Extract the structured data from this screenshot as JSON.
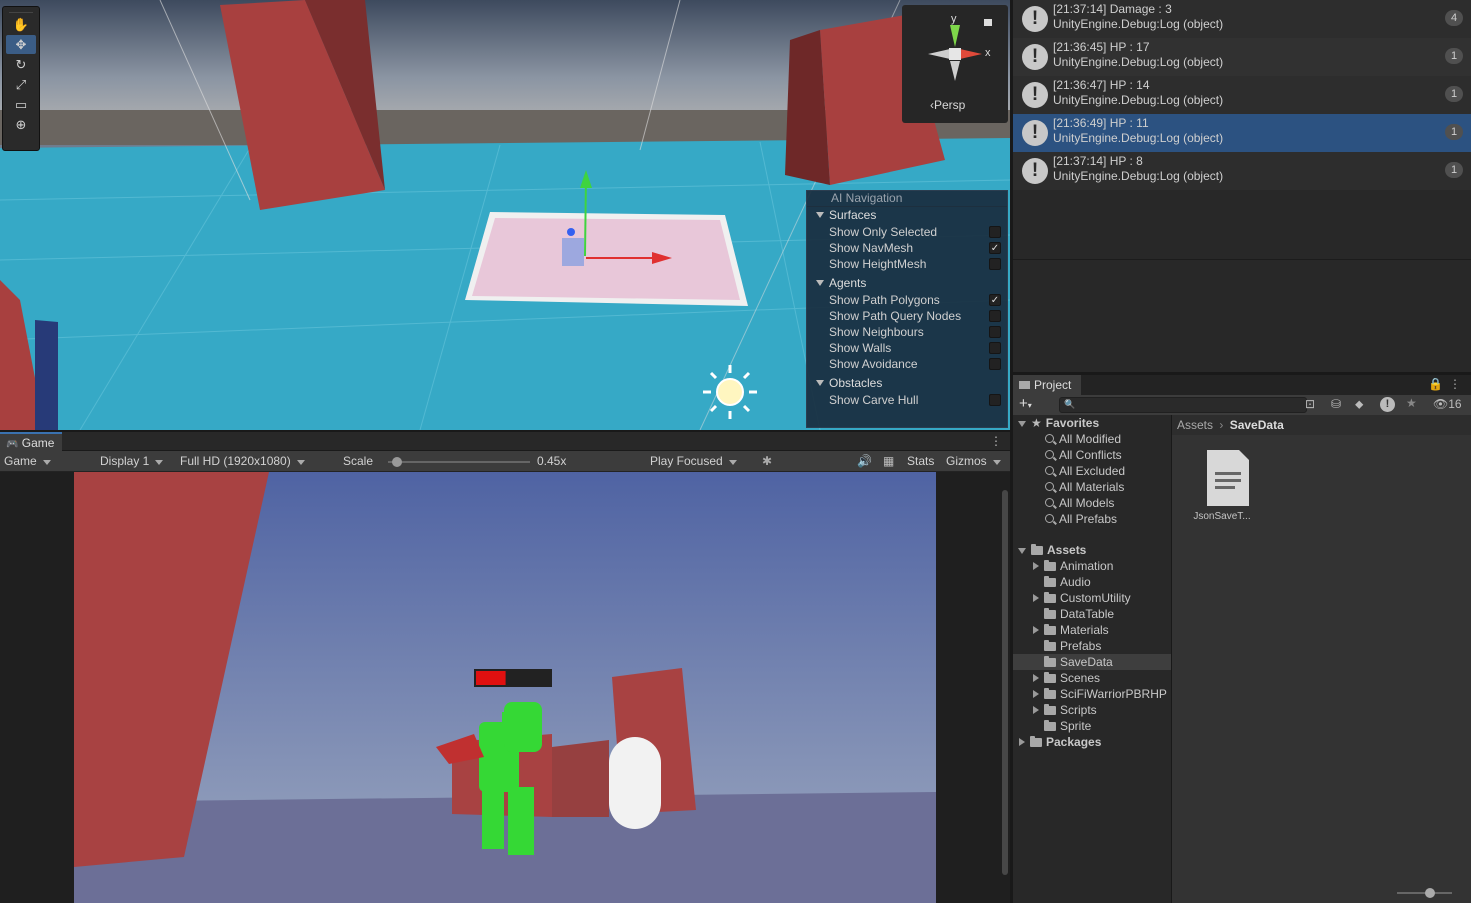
{
  "scene": {
    "tools": [
      "hand-tool",
      "move-tool",
      "rotate-tool",
      "scale-tool",
      "rect-tool",
      "transform-tool"
    ],
    "gizmo_axis": "y",
    "gizmo_x": "x",
    "projection": "Persp",
    "ai_navigation": {
      "title": "AI Navigation",
      "sections": [
        {
          "label": "Surfaces",
          "options": [
            {
              "label": "Show Only Selected",
              "checked": false
            },
            {
              "label": "Show NavMesh",
              "checked": true
            },
            {
              "label": "Show HeightMesh",
              "checked": false
            }
          ]
        },
        {
          "label": "Agents",
          "options": [
            {
              "label": "Show Path Polygons",
              "checked": true
            },
            {
              "label": "Show Path Query Nodes",
              "checked": false
            },
            {
              "label": "Show Neighbours",
              "checked": false
            },
            {
              "label": "Show Walls",
              "checked": false
            },
            {
              "label": "Show Avoidance",
              "checked": false
            }
          ]
        },
        {
          "label": "Obstacles",
          "options": [
            {
              "label": "Show Carve Hull",
              "checked": false
            }
          ]
        }
      ]
    }
  },
  "game": {
    "tab": "Game",
    "mode": "Game",
    "display": "Display 1",
    "resolution": "Full HD (1920x1080)",
    "scale_label": "Scale",
    "scale_value": "0.45x",
    "scale_fraction": 0.06,
    "play_mode": "Play Focused",
    "stats": "Stats",
    "gizmos": "Gizmos",
    "hp_fraction": 0.4,
    "colors": {
      "sky": "#5f70a8",
      "ground": "#6a6f96",
      "wall": "#a64444",
      "player": "#2fd32f",
      "hp": "#e01010"
    }
  },
  "console": {
    "logs": [
      {
        "line1": "[21:37:14] Damage : 3",
        "line2": "UnityEngine.Debug:Log (object)",
        "count": "4"
      },
      {
        "line1": "[21:36:45] HP : 17",
        "line2": "UnityEngine.Debug:Log (object)",
        "count": "1"
      },
      {
        "line1": "[21:36:47] HP : 14",
        "line2": "UnityEngine.Debug:Log (object)",
        "count": "1"
      },
      {
        "line1": "[21:36:49] HP : 11",
        "line2": "UnityEngine.Debug:Log (object)",
        "count": "1"
      },
      {
        "line1": "[21:37:14] HP : 8",
        "line2": "UnityEngine.Debug:Log (object)",
        "count": "1"
      }
    ],
    "selected_index": 3
  },
  "project": {
    "tab": "Project",
    "search_placeholder": "",
    "hidden_count": "16",
    "favorites_label": "Favorites",
    "favorites": [
      "All Modified",
      "All Conflicts",
      "All Excluded",
      "All Materials",
      "All Models",
      "All Prefabs"
    ],
    "assets_label": "Assets",
    "assets": [
      {
        "label": "Animation",
        "expandable": true
      },
      {
        "label": "Audio",
        "expandable": false
      },
      {
        "label": "CustomUtility",
        "expandable": true
      },
      {
        "label": "DataTable",
        "expandable": false
      },
      {
        "label": "Materials",
        "expandable": true
      },
      {
        "label": "Prefabs",
        "expandable": false
      },
      {
        "label": "SaveData",
        "expandable": false,
        "selected": true
      },
      {
        "label": "Scenes",
        "expandable": true
      },
      {
        "label": "SciFiWarriorPBRHP",
        "expandable": true
      },
      {
        "label": "Scripts",
        "expandable": true
      },
      {
        "label": "Sprite",
        "expandable": false
      }
    ],
    "packages_label": "Packages",
    "breadcrumb": [
      "Assets",
      "SaveData"
    ],
    "files": [
      {
        "label": "JsonSaveT...",
        "icon": "text-file-icon"
      }
    ]
  }
}
